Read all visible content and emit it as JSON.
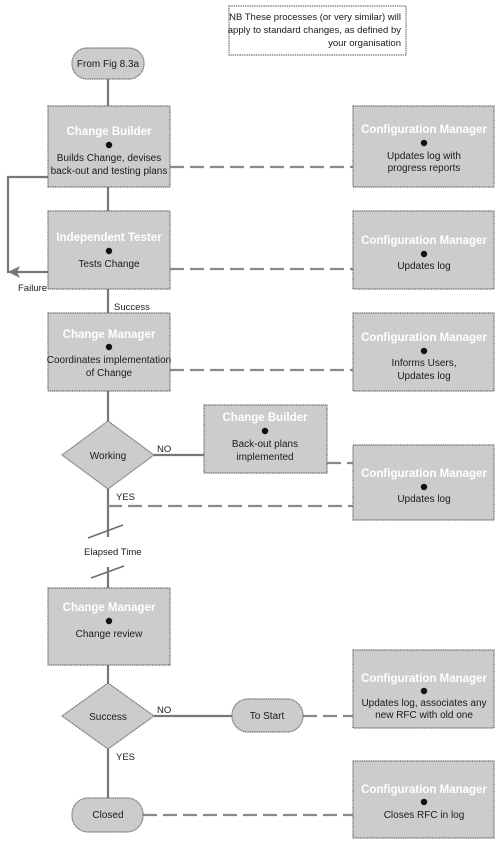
{
  "note": {
    "lines": [
      "NB These processes (or very similar) will",
      "apply to standard changes, as defined by",
      "your organisation"
    ]
  },
  "colors": {
    "box_fill": "#cccccc",
    "box_stroke": "#6e6e6e",
    "role_text": "#ffffff",
    "line": "#777777"
  },
  "start": {
    "label": "From Fig 8.3a"
  },
  "steps": [
    {
      "role": "Change Builder",
      "desc": [
        "Builds Change, devises",
        "back-out and testing plans"
      ]
    },
    {
      "role": "Independent Tester",
      "desc": [
        "Tests Change"
      ]
    },
    {
      "role": "Change Manager",
      "desc": [
        "Coordinates implementation",
        "of Change"
      ]
    },
    {
      "role": "Change Manager",
      "desc": [
        "Change review"
      ]
    }
  ],
  "backout": {
    "role": "Change Builder",
    "desc": [
      "Back-out plans",
      "implemented"
    ]
  },
  "config_boxes": [
    {
      "role": "Configuration Manager",
      "desc": [
        "Updates log with",
        "progress reports"
      ]
    },
    {
      "role": "Configuration Manager",
      "desc": [
        "Updates log"
      ]
    },
    {
      "role": "Configuration Manager",
      "desc": [
        "Informs Users,",
        "Updates log"
      ]
    },
    {
      "role": "Configuration Manager",
      "desc": [
        "Updates log"
      ]
    },
    {
      "role": "Configuration Manager",
      "desc": [
        "Updates log, associates any",
        "new RFC with old one"
      ]
    },
    {
      "role": "Configuration Manager",
      "desc": [
        "Closes RFC in log"
      ]
    }
  ],
  "decisions": [
    {
      "label": "Working",
      "no": "NO",
      "yes": "YES"
    },
    {
      "label": "Success",
      "no": "NO",
      "yes": "YES"
    }
  ],
  "edge_labels": {
    "failure": "Failure",
    "success": "Success",
    "elapsed": "Elapsed Time"
  },
  "terminators": {
    "to_start": "To Start",
    "closed": "Closed"
  }
}
